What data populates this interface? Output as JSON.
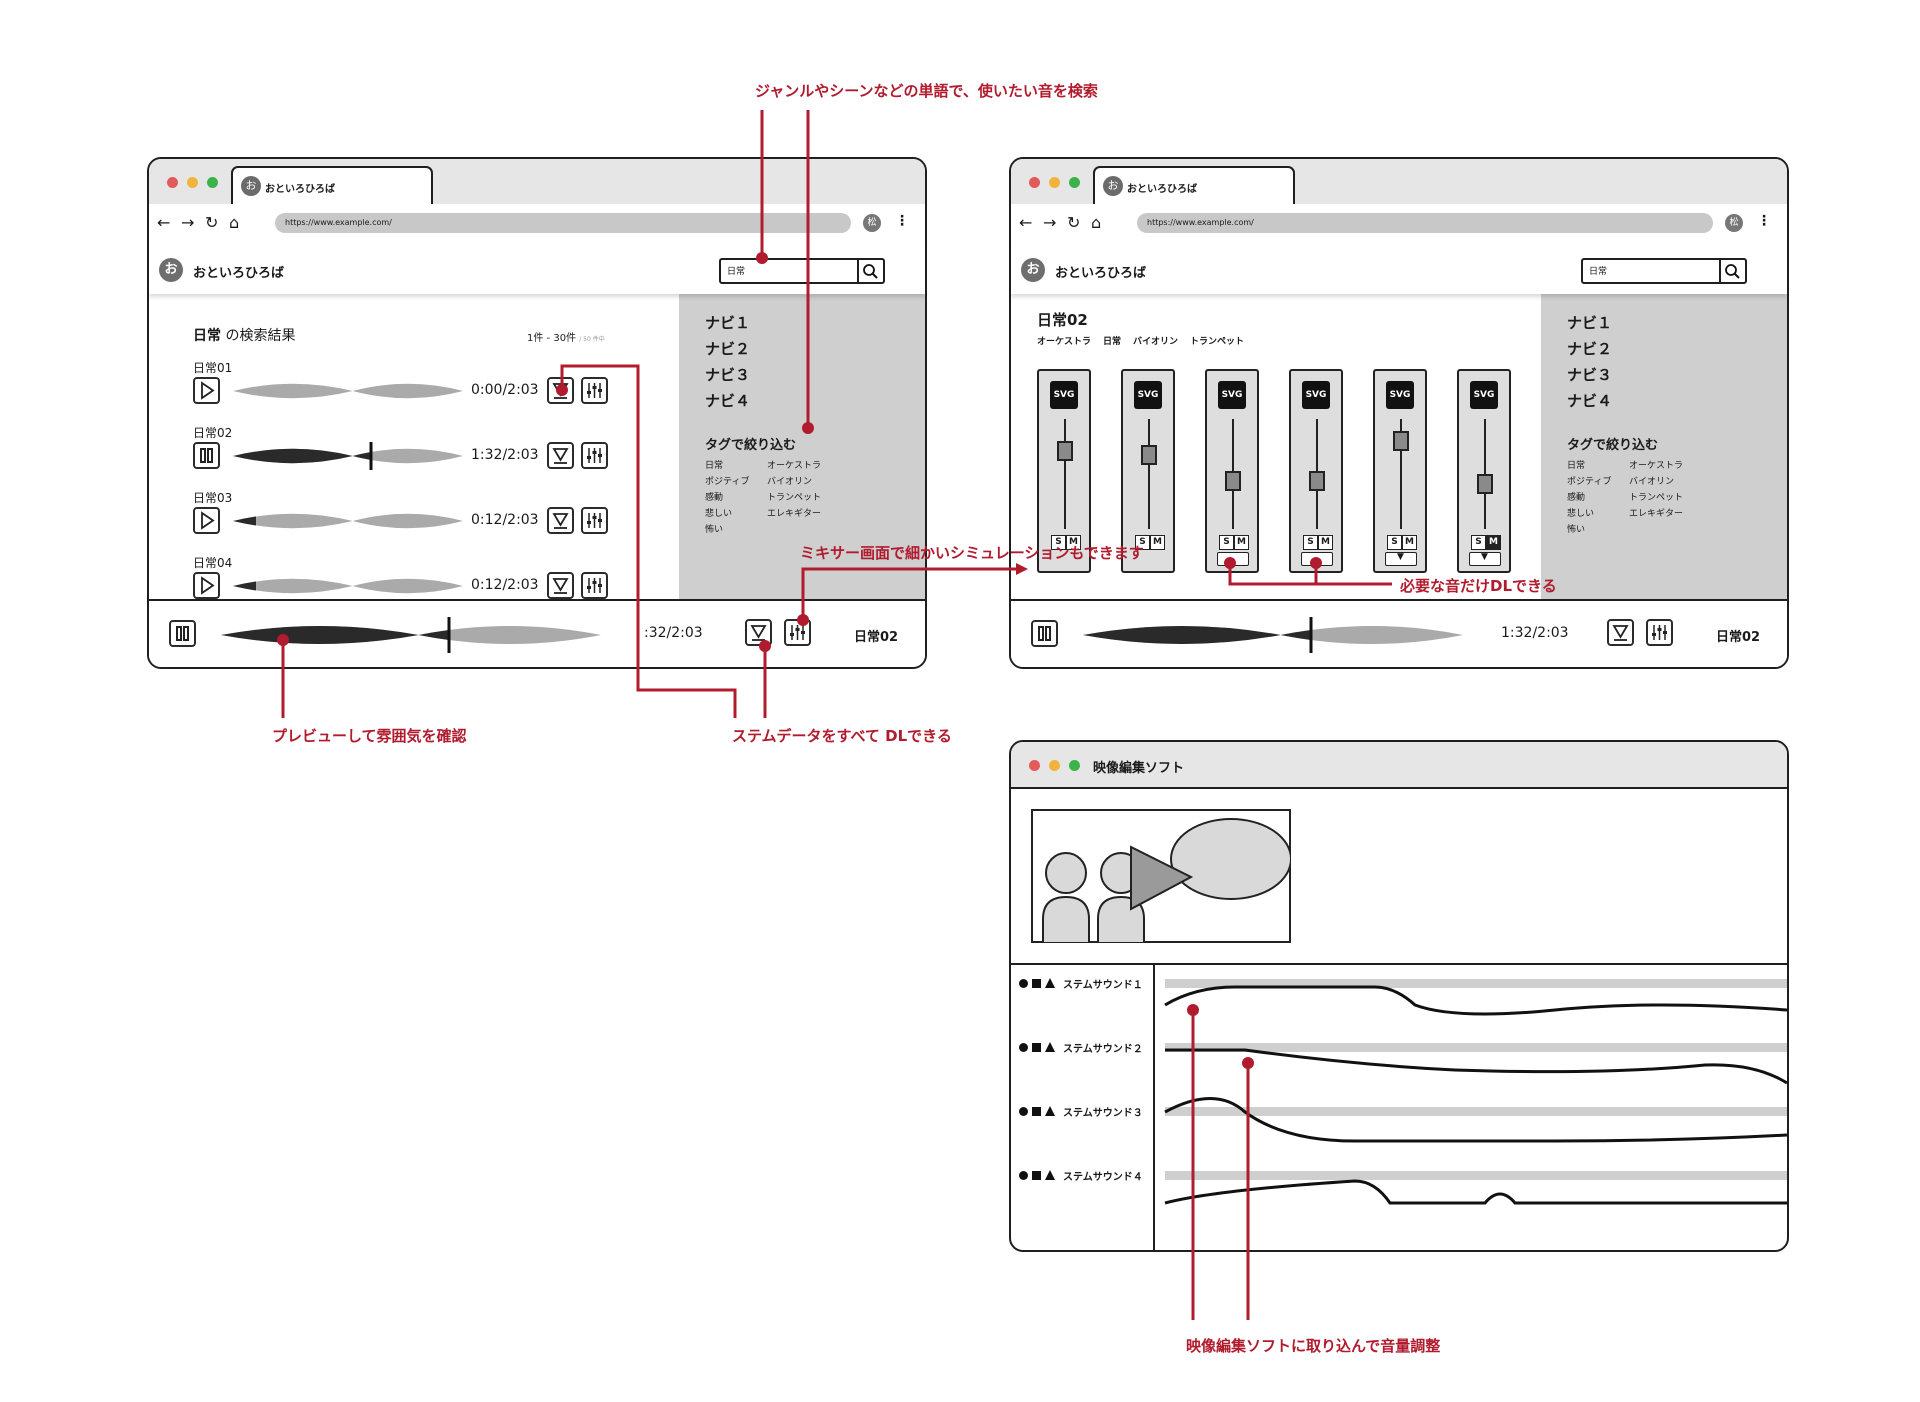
{
  "browser": {
    "tab_title": "おといろひろば",
    "url": "https://www.example.com/",
    "ext_label": "松",
    "nav_icons": [
      "back-icon",
      "forward-icon",
      "reload-icon",
      "home-icon"
    ]
  },
  "site": {
    "logo_letter": "お",
    "name": "おといろひろば"
  },
  "search": {
    "query": "日常",
    "results_keyword": "日常",
    "results_suffix": " の検索結果",
    "range": "1件 - 30件",
    "total": "/ 50 件中"
  },
  "results": [
    {
      "title": "日常01",
      "time": "0:00/2:03",
      "state": "play",
      "progress": 0.0
    },
    {
      "title": "日常02",
      "time": "1:32/2:03",
      "state": "pause",
      "progress": 0.6
    },
    {
      "title": "日常03",
      "time": "0:12/2:03",
      "state": "play",
      "progress": 0.1
    },
    {
      "title": "日常04",
      "time": "0:12/2:03",
      "state": "play",
      "progress": 0.1
    }
  ],
  "sidebar": {
    "navi": [
      "ナビ１",
      "ナビ２",
      "ナビ３",
      "ナビ４"
    ],
    "tag_heading": "タグで絞り込む",
    "tags_left": [
      "日常",
      "ポジティブ",
      "感動",
      "悲しい",
      "怖い"
    ],
    "tags_right": [
      "オーケストラ",
      "バイオリン",
      "トランペット",
      "エレキギター"
    ]
  },
  "player": {
    "time_left": ":32/2:03",
    "time_right": "1:32/2:03",
    "track": "日常02",
    "progress": 0.6
  },
  "mixer": {
    "title": "日常02",
    "tags": [
      "オーケストラ",
      "日常",
      "バイオリン",
      "トランペット"
    ],
    "channel_icon": "SVG",
    "solo": "S",
    "mute": "M",
    "fader_levels": [
      0.78,
      0.74,
      0.48,
      0.48,
      0.88,
      0.45
    ],
    "download_state": [
      "none",
      "none",
      "outline",
      "outline",
      "icon",
      "icon"
    ]
  },
  "video_editor": {
    "title": "映像編集ソフト",
    "tracks": [
      "ステムサウンド１",
      "ステムサウンド２",
      "ステムサウンド３",
      "ステムサウンド４"
    ]
  },
  "annotations": {
    "search": "ジャンルやシーンなどの単語で、使いたい音を検索",
    "mixer": "ミキサー画面で細かいシミュレーションもできます",
    "stem_dl": "必要な音だけDLできる",
    "preview": "プレビューして雰囲気を確認",
    "all_dl": "ステムデータをすべて DLできる",
    "import": "映像編集ソフトに取り込んで音量調整"
  },
  "colors": {
    "accent": "#b01c2e",
    "wave_light": "#aaaaaa",
    "wave_dark": "#2a2a2a",
    "sidebar": "#cfcfcf"
  }
}
